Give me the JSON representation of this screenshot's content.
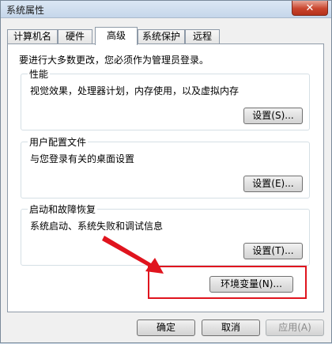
{
  "window": {
    "title": "系统属性",
    "close_label": "✕"
  },
  "tabs": [
    {
      "label": "计算机名"
    },
    {
      "label": "硬件"
    },
    {
      "label": "高级",
      "active": true
    },
    {
      "label": "系统保护"
    },
    {
      "label": "远程"
    }
  ],
  "panel": {
    "admin_note": "要进行大多数更改，您必须作为管理员登录。",
    "groups": [
      {
        "title": "性能",
        "desc": "视觉效果，处理器计划，内存使用，以及虚拟内存",
        "button": "设置(S)..."
      },
      {
        "title": "用户配置文件",
        "desc": "与您登录有关的桌面设置",
        "button": "设置(E)..."
      },
      {
        "title": "启动和故障恢复",
        "desc": "系统启动、系统失败和调试信息",
        "button": "设置(T)..."
      }
    ],
    "env_button": "环境变量(N)..."
  },
  "footer": {
    "ok": "确定",
    "cancel": "取消",
    "apply": "应用(A)"
  },
  "annotation": {
    "color": "#e0141e"
  }
}
